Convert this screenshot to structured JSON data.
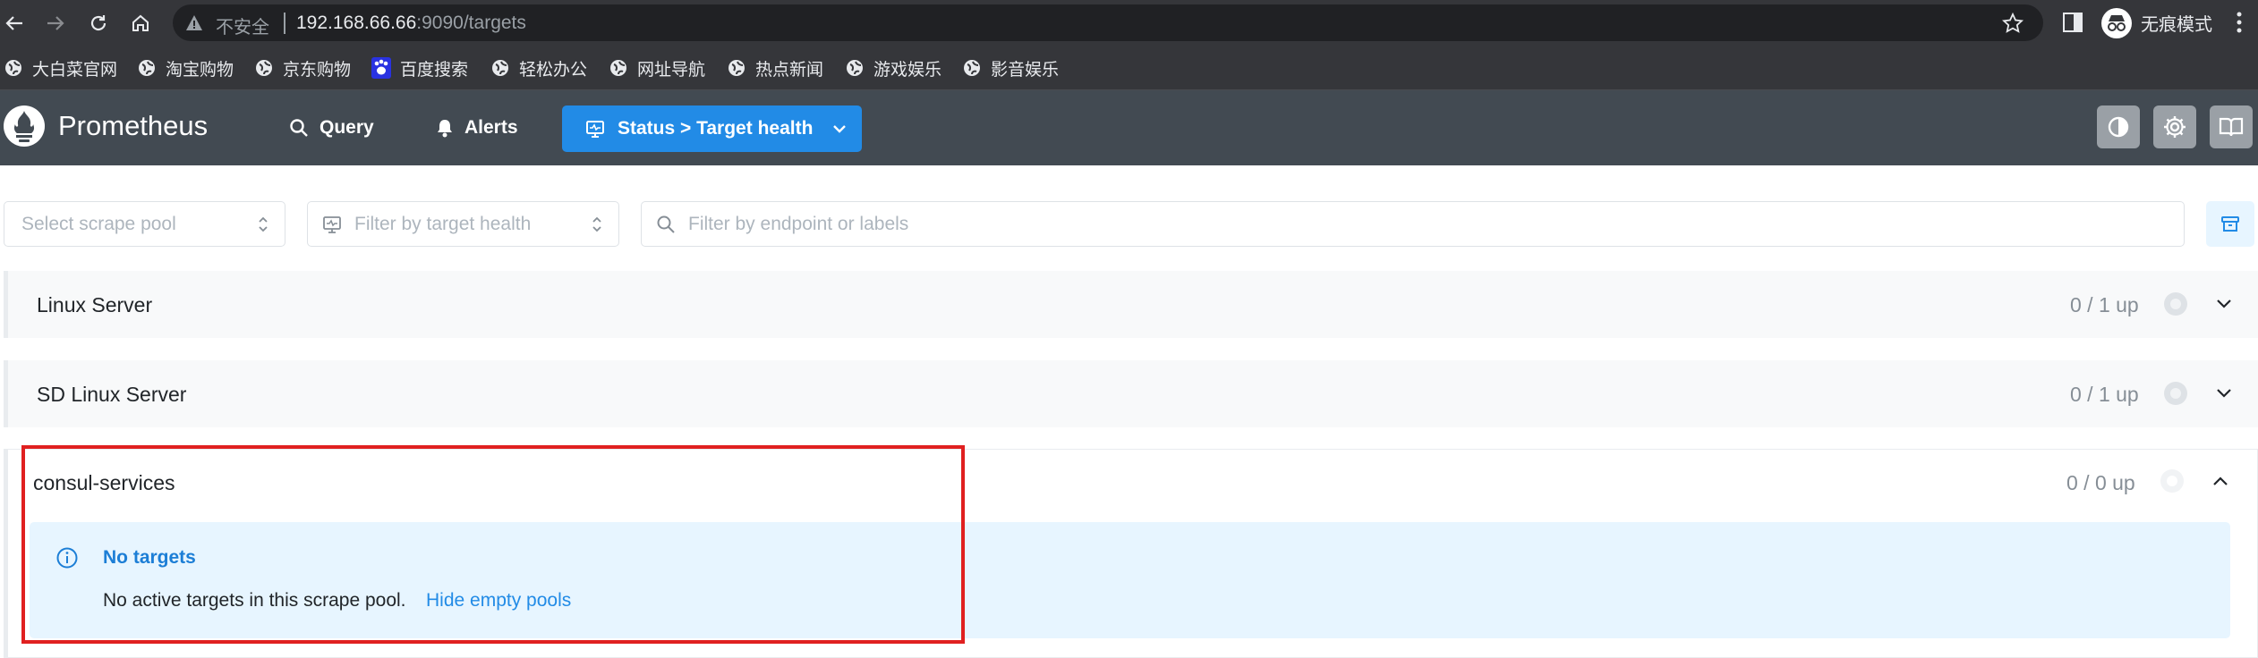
{
  "browser": {
    "insecure_label": "不安全",
    "url_host": "192.168.66.66",
    "url_rest": ":9090/targets",
    "incognito_label": "无痕模式",
    "bookmarks": [
      {
        "label": "大白菜官网",
        "icon": "globe-icon"
      },
      {
        "label": "淘宝购物",
        "icon": "globe-icon"
      },
      {
        "label": "京东购物",
        "icon": "globe-icon"
      },
      {
        "label": "百度搜索",
        "icon": "baidu-paw-icon"
      },
      {
        "label": "轻松办公",
        "icon": "globe-icon"
      },
      {
        "label": "网址导航",
        "icon": "globe-icon"
      },
      {
        "label": "热点新闻",
        "icon": "globe-icon"
      },
      {
        "label": "游戏娱乐",
        "icon": "globe-icon"
      },
      {
        "label": "影音娱乐",
        "icon": "globe-icon"
      }
    ]
  },
  "header": {
    "brand": "Prometheus",
    "nav": {
      "query": "Query",
      "alerts": "Alerts",
      "status": "Status > Target health"
    },
    "accent": "#228be6",
    "background": "#424a52"
  },
  "filters": {
    "scrape_pool_placeholder": "Select scrape pool",
    "health_placeholder": "Filter by target health",
    "search_placeholder": "Filter by endpoint or labels"
  },
  "pools": [
    {
      "name": "Linux Server",
      "count": "0 / 1 up",
      "expanded": false
    },
    {
      "name": "SD Linux Server",
      "count": "0 / 1 up",
      "expanded": false
    },
    {
      "name": "consul-services",
      "count": "0 / 0 up",
      "expanded": true
    }
  ],
  "empty_alert": {
    "title": "No targets",
    "message": "No active targets in this scrape pool.",
    "link": "Hide empty pools"
  }
}
